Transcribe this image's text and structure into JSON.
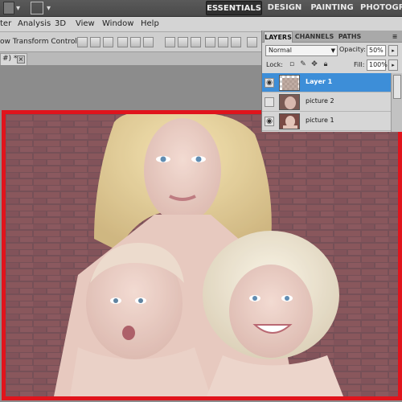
{
  "appbar": {
    "workspaces": [
      "ESSENTIALS",
      "DESIGN",
      "PAINTING",
      "PHOTOGRA"
    ]
  },
  "menubar": {
    "items": [
      "ter",
      "Analysis",
      "3D",
      "View",
      "Window",
      "Help"
    ]
  },
  "options": {
    "show_transform_label": "ow Transform Controls"
  },
  "document": {
    "tab_label": "#) *",
    "close_glyph": "×"
  },
  "layers_panel": {
    "tabs": [
      "LAYERS",
      "CHANNELS",
      "PATHS"
    ],
    "blend_mode": "Normal",
    "opacity_label": "Opacity:",
    "opacity_value": "50%",
    "lock_label": "Lock:",
    "fill_label": "Fill:",
    "fill_value": "100%",
    "layers": [
      {
        "name": "Layer 1",
        "selected": true,
        "visible": true
      },
      {
        "name": "picture 2",
        "selected": false,
        "visible": false
      },
      {
        "name": "picture 1",
        "selected": false,
        "visible": true
      }
    ]
  },
  "colors": {
    "selection_highlight": "#3d8ed8",
    "canvas_border": "#e0141c"
  },
  "icons": {
    "eye": "eye-icon",
    "lock": "lock-icon",
    "move": "move-icon",
    "brush": "brush-icon"
  }
}
